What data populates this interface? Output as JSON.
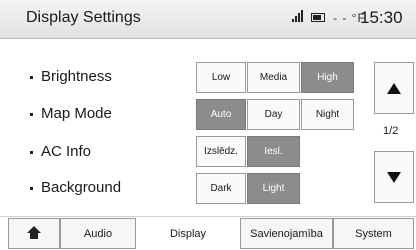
{
  "header": {
    "title": "Display Settings",
    "temperature": "- - °F",
    "clock": "15:30",
    "icons": [
      "signal-icon",
      "battery-icon"
    ]
  },
  "settings": {
    "brightness": {
      "label": "Brightness",
      "options": [
        "Low",
        "Media",
        "High"
      ],
      "selected": "High"
    },
    "map_mode": {
      "label": "Map Mode",
      "options": [
        "Auto",
        "Day",
        "Night"
      ],
      "selected": "Auto"
    },
    "ac_info": {
      "label": "AC Info",
      "options": [
        "Izslēdz.",
        "Iesl."
      ],
      "selected": "Iesl."
    },
    "background": {
      "label": "Background",
      "options": [
        "Dark",
        "Light"
      ],
      "selected": "Light"
    }
  },
  "pager": {
    "indicator": "1/2",
    "up_icon": "arrow-up-icon",
    "down_icon": "arrow-down-icon"
  },
  "tabs": {
    "home_icon": "home-icon",
    "items": [
      "Audio",
      "Display",
      "Savienojamība",
      "System"
    ],
    "active": "Display"
  },
  "colors": {
    "selected_bg": "#8c8c8c",
    "selected_text": "#ffffff",
    "unselected_bg": "#fafafa"
  }
}
